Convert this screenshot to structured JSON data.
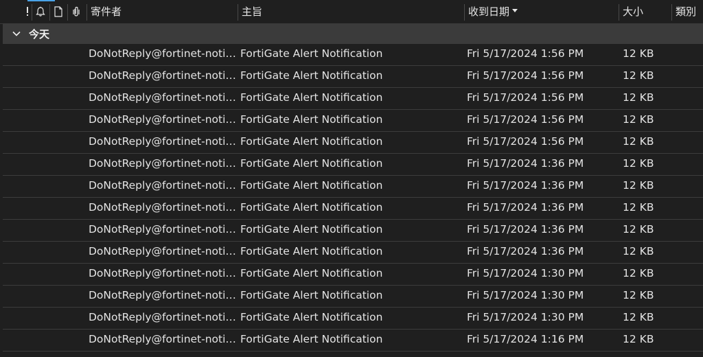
{
  "header": {
    "importance_icon": "exclamation-icon",
    "reminder_icon": "bell-icon",
    "document_icon": "document-icon",
    "attachment_icon": "paperclip-icon",
    "from_label": "寄件者",
    "subject_label": "主旨",
    "received_label": "收到日期",
    "size_label": "大小",
    "category_label": "類別"
  },
  "group": {
    "label": "今天"
  },
  "messages": [
    {
      "from": "DoNotReply@fortinet-notifications.com",
      "subject": "FortiGate Alert Notification",
      "received": "Fri 5/17/2024 1:56 PM",
      "size": "12 KB"
    },
    {
      "from": "DoNotReply@fortinet-notifications.com",
      "subject": "FortiGate Alert Notification",
      "received": "Fri 5/17/2024 1:56 PM",
      "size": "12 KB"
    },
    {
      "from": "DoNotReply@fortinet-notifications.com",
      "subject": "FortiGate Alert Notification",
      "received": "Fri 5/17/2024 1:56 PM",
      "size": "12 KB"
    },
    {
      "from": "DoNotReply@fortinet-notifications.com",
      "subject": "FortiGate Alert Notification",
      "received": "Fri 5/17/2024 1:56 PM",
      "size": "12 KB"
    },
    {
      "from": "DoNotReply@fortinet-notifications.com",
      "subject": "FortiGate Alert Notification",
      "received": "Fri 5/17/2024 1:56 PM",
      "size": "12 KB"
    },
    {
      "from": "DoNotReply@fortinet-notifications.com",
      "subject": "FortiGate Alert Notification",
      "received": "Fri 5/17/2024 1:36 PM",
      "size": "12 KB"
    },
    {
      "from": "DoNotReply@fortinet-notifications.com",
      "subject": "FortiGate Alert Notification",
      "received": "Fri 5/17/2024 1:36 PM",
      "size": "12 KB"
    },
    {
      "from": "DoNotReply@fortinet-notifications.com",
      "subject": "FortiGate Alert Notification",
      "received": "Fri 5/17/2024 1:36 PM",
      "size": "12 KB"
    },
    {
      "from": "DoNotReply@fortinet-notifications.com",
      "subject": "FortiGate Alert Notification",
      "received": "Fri 5/17/2024 1:36 PM",
      "size": "12 KB"
    },
    {
      "from": "DoNotReply@fortinet-notifications.com",
      "subject": "FortiGate Alert Notification",
      "received": "Fri 5/17/2024 1:36 PM",
      "size": "12 KB"
    },
    {
      "from": "DoNotReply@fortinet-notifications.com",
      "subject": "FortiGate Alert Notification",
      "received": "Fri 5/17/2024 1:30 PM",
      "size": "12 KB"
    },
    {
      "from": "DoNotReply@fortinet-notifications.com",
      "subject": "FortiGate Alert Notification",
      "received": "Fri 5/17/2024 1:30 PM",
      "size": "12 KB"
    },
    {
      "from": "DoNotReply@fortinet-notifications.com",
      "subject": "FortiGate Alert Notification",
      "received": "Fri 5/17/2024 1:30 PM",
      "size": "12 KB"
    },
    {
      "from": "DoNotReply@fortinet-notifications.com",
      "subject": "FortiGate Alert Notification",
      "received": "Fri 5/17/2024 1:16 PM",
      "size": "12 KB"
    }
  ],
  "colors": {
    "background": "#1f1f1f",
    "group_background": "#3b3b3b",
    "accent": "#4aa3e8",
    "text": "#e4e4e4",
    "row_divider": "#3d3d3d"
  }
}
